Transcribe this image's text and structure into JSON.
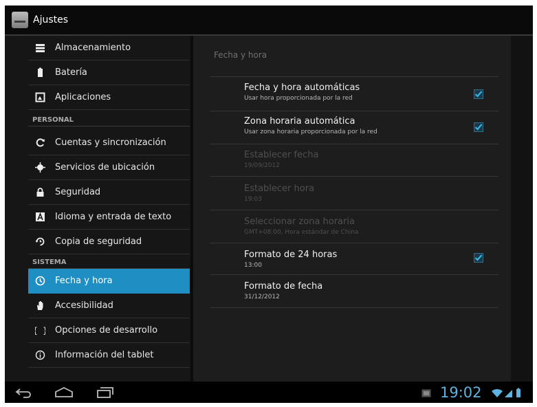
{
  "app": {
    "title": "Ajustes"
  },
  "sidebar": {
    "items_top": [
      {
        "label": "Almacenamiento",
        "icon": "storage-icon"
      },
      {
        "label": "Batería",
        "icon": "battery-icon"
      },
      {
        "label": "Aplicaciones",
        "icon": "apps-icon"
      }
    ],
    "section_personal": "PERSONAL",
    "items_personal": [
      {
        "label": "Cuentas y sincronización",
        "icon": "sync-icon"
      },
      {
        "label": "Servicios de ubicación",
        "icon": "location-icon"
      },
      {
        "label": "Seguridad",
        "icon": "lock-icon"
      },
      {
        "label": "Idioma y entrada de texto",
        "icon": "language-icon"
      },
      {
        "label": "Copia de seguridad",
        "icon": "backup-icon"
      }
    ],
    "section_sistema": "SISTEMA",
    "items_sistema": [
      {
        "label": "Fecha y hora",
        "icon": "clock-icon",
        "active": true
      },
      {
        "label": "Accesibilidad",
        "icon": "hand-icon"
      },
      {
        "label": "Opciones de desarrollo",
        "icon": "braces-icon"
      },
      {
        "label": "Información del tablet",
        "icon": "info-icon"
      }
    ]
  },
  "detail": {
    "header": "Fecha y hora",
    "items": [
      {
        "title": "Fecha y hora automáticas",
        "summary": "Usar hora proporcionada por la red",
        "enabled": true,
        "checked": true
      },
      {
        "title": "Zona horaria automática",
        "summary": "Usar zona horaria proporcionada por la red",
        "enabled": true,
        "checked": true
      },
      {
        "title": "Establecer fecha",
        "summary": "19/09/2012",
        "enabled": false
      },
      {
        "title": "Establecer hora",
        "summary": "19:03",
        "enabled": false
      },
      {
        "title": "Seleccionar zona horaria",
        "summary": "GMT+08:00, Hora estándar de China",
        "enabled": false
      },
      {
        "title": "Formato de 24 horas",
        "summary": "13:00",
        "enabled": true,
        "checked": true
      },
      {
        "title": "Formato de fecha",
        "summary": "31/12/2012",
        "enabled": true
      }
    ]
  },
  "statusbar": {
    "time": "19:02"
  },
  "colors": {
    "accent": "#1f8fc3",
    "clock": "#5fb3e0",
    "check": "#33b5e5"
  }
}
